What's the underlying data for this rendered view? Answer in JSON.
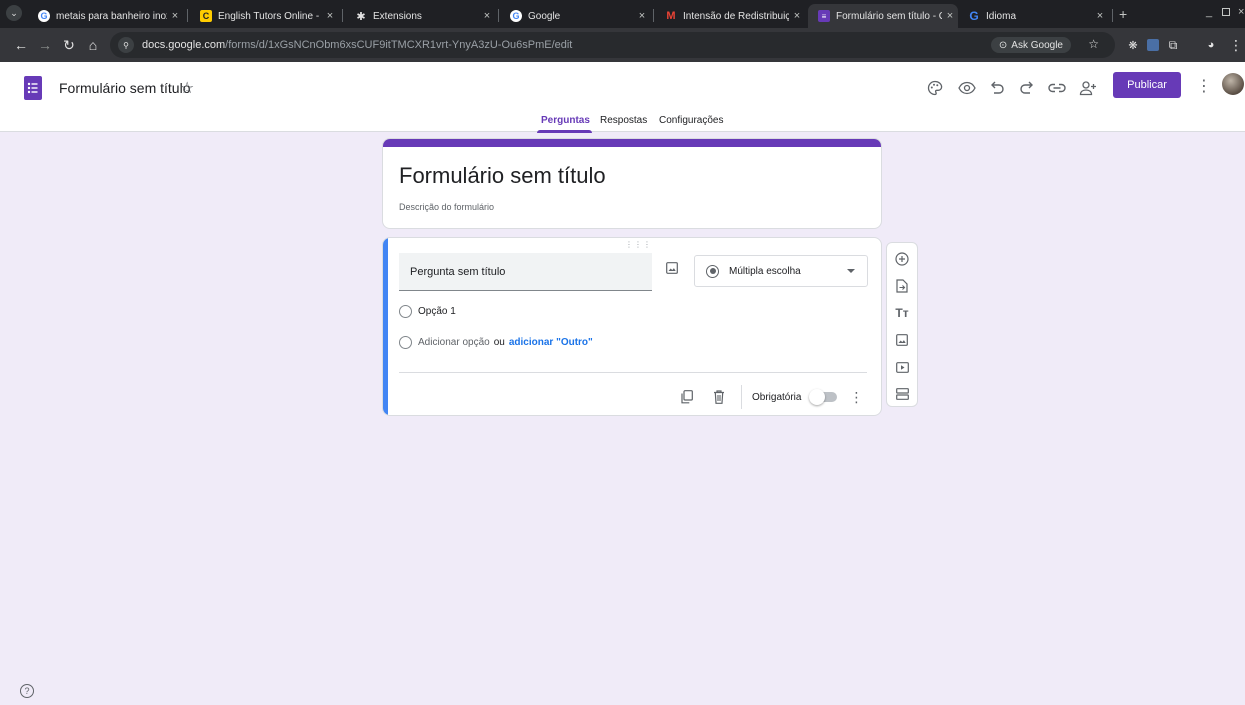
{
  "browser": {
    "tabs": [
      {
        "title": "metais para banheiro inox - G",
        "close": "×"
      },
      {
        "title": "English Tutors Online - Camb",
        "close": "×"
      },
      {
        "title": "Extensions",
        "close": "×"
      },
      {
        "title": "Google",
        "close": "×"
      },
      {
        "title": "Intensão de Redistribuição/F",
        "close": "×"
      },
      {
        "title": "Formulário sem título - Goog",
        "close": "×"
      },
      {
        "title": "Idioma",
        "close": "×"
      }
    ],
    "new_tab": "+",
    "url_host": "docs.google.com",
    "url_path": "/forms/d/1xGsNCnObm6xsCUF9itTMCXR1vrt-YnyA3zU-Ou6sPmE/edit",
    "ask_google": "Ask Google"
  },
  "header": {
    "doc_title": "Formulário sem título",
    "publish_label": "Publicar"
  },
  "nav_tabs": [
    "Perguntas",
    "Respostas",
    "Configurações"
  ],
  "form": {
    "title": "Formulário sem título",
    "description": "Descrição do formulário"
  },
  "question": {
    "title": "Pergunta sem título",
    "type": "Múltipla escolha",
    "option1": "Opção 1",
    "add_option": "Adicionar opção",
    "or": "ou",
    "add_other": "adicionar \"Outro\"",
    "required_label": "Obrigatória",
    "required": false
  },
  "colors": {
    "accent": "#673ab7",
    "background": "#f0ebf8",
    "active_question_bar": "#4285f4"
  },
  "help_icon": "?"
}
